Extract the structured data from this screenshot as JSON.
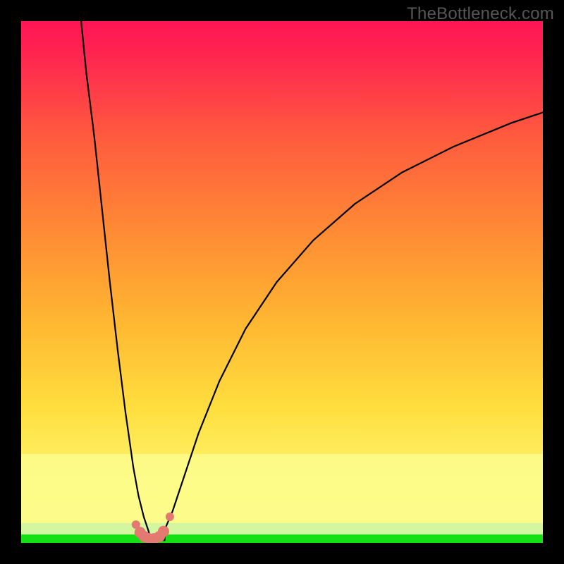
{
  "watermark": "TheBottleneck.com",
  "colors": {
    "frame": "#000000",
    "curve": "#000000",
    "markers": "#e37970",
    "green_band": "#13e114",
    "pale_green": "#d2f7a0",
    "yellow_band": "#fdfd8d",
    "gradient_top": "#ff1455",
    "gradient_mid": "#ffcf3a",
    "gradient_bot": "#fdfd8d"
  },
  "chart_data": {
    "type": "line",
    "title": "",
    "xlabel": "",
    "ylabel": "",
    "xlim": [
      0,
      100
    ],
    "ylim": [
      0,
      100
    ],
    "grid": false,
    "legend": false,
    "description": "Two-branch bottleneck curve. Left branch falls steeply from top-left toward the trough near x≈25; right branch rises with decreasing slope toward the right edge. The trough (y≈0) is near x≈22–28. Red dot markers sit along the trough. A horizontal green band at y≈0 and a wider pale-yellow band immediately above it span the full width.",
    "series": [
      {
        "name": "curve-left",
        "x": [
          11.5,
          12.5,
          14.0,
          15.5,
          17.0,
          18.5,
          20.0,
          21.5,
          22.5,
          23.5,
          24.5
        ],
        "y": [
          100.0,
          90.0,
          78.0,
          64.0,
          50.0,
          37.0,
          25.0,
          14.5,
          9.0,
          5.0,
          2.0
        ]
      },
      {
        "name": "curve-right",
        "x": [
          27.5,
          29.0,
          31.0,
          34.0,
          38.0,
          43.0,
          49.0,
          56.0,
          64.0,
          73.0,
          83.0,
          94.0,
          100.0
        ],
        "y": [
          2.5,
          6.0,
          12.0,
          21.0,
          31.0,
          41.0,
          50.0,
          58.0,
          65.0,
          71.0,
          76.0,
          80.5,
          82.5
        ]
      },
      {
        "name": "trough-markers",
        "x": [
          22.0,
          22.8,
          23.6,
          24.5,
          25.5,
          26.5,
          27.3,
          28.5
        ],
        "y": [
          3.5,
          2.0,
          1.2,
          0.8,
          0.8,
          1.2,
          2.2,
          5.0
        ]
      }
    ],
    "bands": {
      "green": {
        "y0": 0.0,
        "y1": 1.6
      },
      "pale": {
        "y0": 1.6,
        "y1": 3.8
      },
      "yellow": {
        "y0": 3.8,
        "y1": 17.0
      }
    }
  }
}
